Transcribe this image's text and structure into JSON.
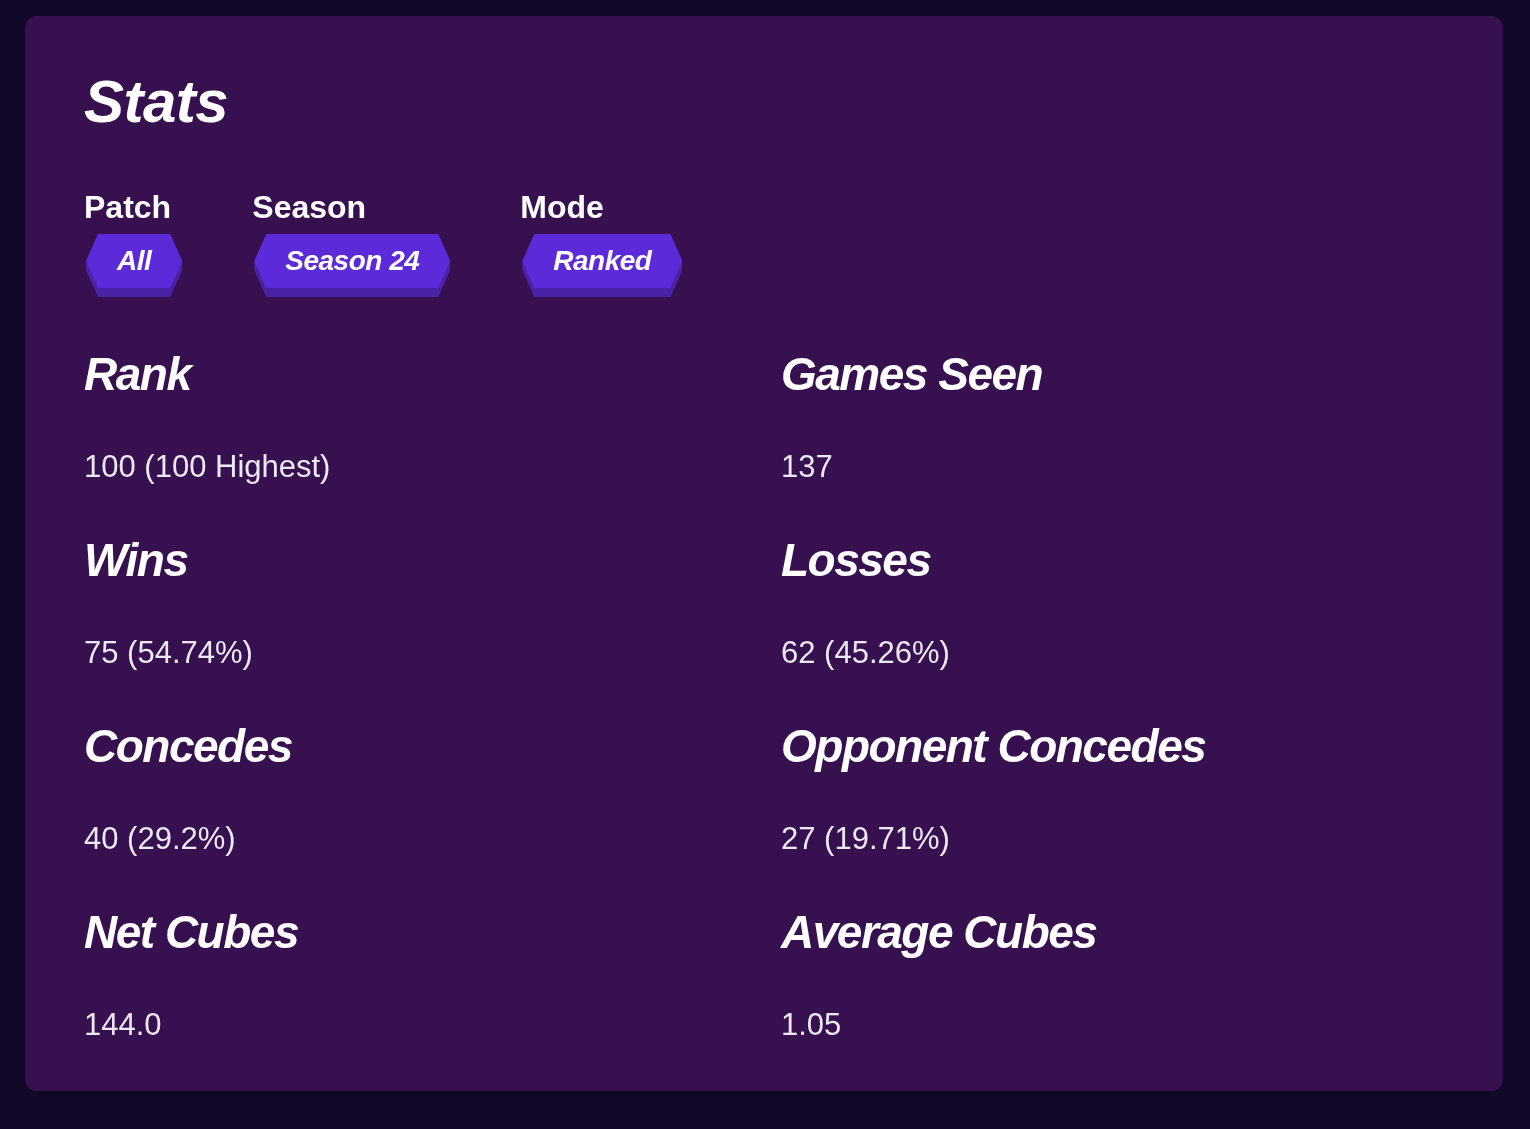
{
  "title": "Stats",
  "filters": [
    {
      "label": "Patch",
      "value": "All"
    },
    {
      "label": "Season",
      "value": "Season 24"
    },
    {
      "label": "Mode",
      "value": "Ranked"
    }
  ],
  "stats": [
    {
      "label": "Rank",
      "value": "100 (100 Highest)"
    },
    {
      "label": "Games Seen",
      "value": "137"
    },
    {
      "label": "Wins",
      "value": "75 (54.74%)"
    },
    {
      "label": "Losses",
      "value": "62 (45.26%)"
    },
    {
      "label": "Concedes",
      "value": "40 (29.2%)"
    },
    {
      "label": "Opponent Concedes",
      "value": "27 (19.71%)"
    },
    {
      "label": "Net Cubes",
      "value": "144.0"
    },
    {
      "label": "Average Cubes",
      "value": "1.05"
    }
  ]
}
